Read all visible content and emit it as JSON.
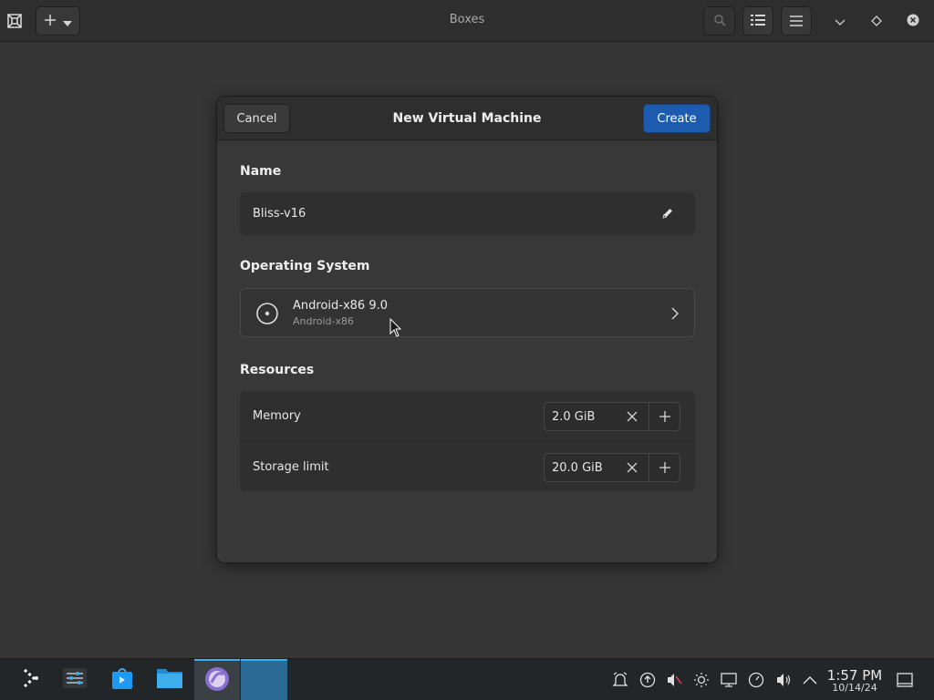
{
  "app": {
    "title": "Boxes"
  },
  "header": {
    "new_button_icon": "plus-icon",
    "dropdown_icon": "chevron-down-icon",
    "search_icon": "search-icon",
    "list_view_icon": "list-view-icon",
    "menu_icon": "hamburger-menu-icon",
    "window_controls": [
      "minimize-icon",
      "maximize-icon",
      "close-icon"
    ]
  },
  "dialog": {
    "title": "New Virtual Machine",
    "cancel_label": "Cancel",
    "create_label": "Create",
    "name_section": {
      "label": "Name",
      "value": "Bliss-v16",
      "edit_icon": "pencil-icon"
    },
    "os_section": {
      "label": "Operating System",
      "os_name": "Android-x86 9.0",
      "os_family": "Android-x86",
      "icon": "disc-icon"
    },
    "resources_section": {
      "label": "Resources",
      "rows": [
        {
          "label": "Memory",
          "value": "2.0 GiB"
        },
        {
          "label": "Storage limit",
          "value": "20.0 GiB"
        }
      ]
    }
  },
  "taskbar": {
    "launcher_icon": "app-launcher-icon",
    "pinned": [
      "system-settings-icon",
      "discover-store-icon",
      "file-manager-icon",
      "boxes-app-icon",
      "active-window-icon"
    ],
    "tray": [
      "alarm-icon",
      "update-icon",
      "volume-muted-icon",
      "brightness-icon",
      "display-icon",
      "timer-icon",
      "volume-icon",
      "chevron-up-icon"
    ],
    "clock_time": "1:57 PM",
    "clock_date": "10/14/24",
    "show_desktop_icon": "show-desktop-icon"
  },
  "colors": {
    "accent": "#1c5bad",
    "background": "#363636",
    "header": "#2e2e2e",
    "taskbar": "#232629"
  }
}
